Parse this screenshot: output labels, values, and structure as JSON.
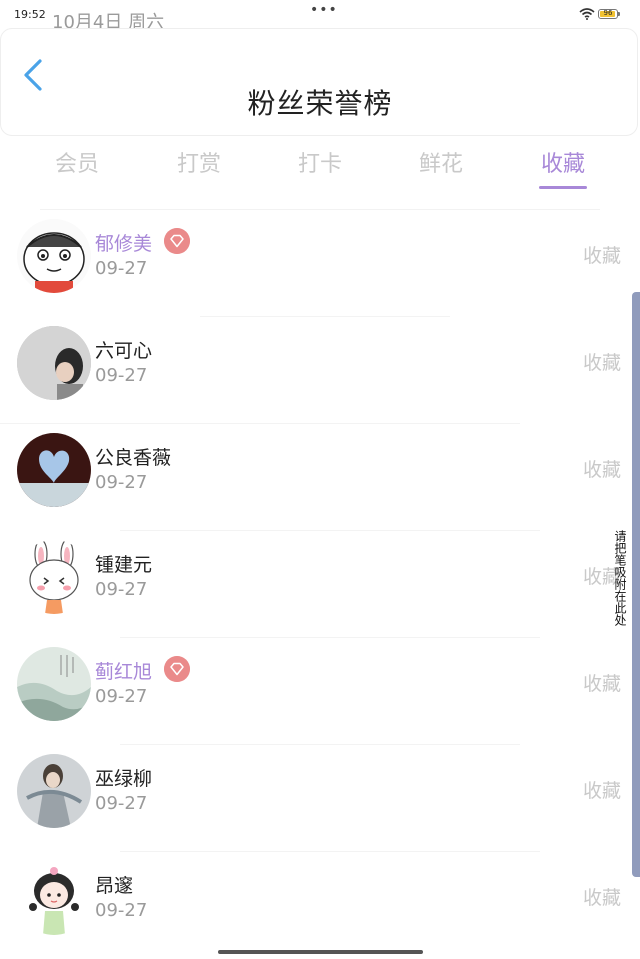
{
  "status": {
    "time": "19:52",
    "date": "10月4日 周六",
    "more": "•••",
    "battery": "96"
  },
  "header": {
    "title": "粉丝荣誉榜"
  },
  "tabs": [
    {
      "label": "会员"
    },
    {
      "label": "打赏"
    },
    {
      "label": "打卡"
    },
    {
      "label": "鲜花"
    },
    {
      "label": "收藏"
    }
  ],
  "active_tab": "收藏",
  "rows": [
    {
      "name": "郁修美",
      "date": "09-27",
      "action": "收藏",
      "vip": true
    },
    {
      "name": "六可心",
      "date": "09-27",
      "action": "收藏",
      "vip": false
    },
    {
      "name": "公良香薇",
      "date": "09-27",
      "action": "收藏",
      "vip": false
    },
    {
      "name": "锺建元",
      "date": "09-27",
      "action": "收藏",
      "vip": false
    },
    {
      "name": "蓟红旭",
      "date": "09-27",
      "action": "收藏",
      "vip": true
    },
    {
      "name": "巫绿柳",
      "date": "09-27",
      "action": "收藏",
      "vip": false
    },
    {
      "name": "昂邃",
      "date": "09-27",
      "action": "收藏",
      "vip": false
    }
  ],
  "side_panel": {
    "text": "请把笔吸附在此处"
  },
  "colors": {
    "accent": "#a888d8",
    "vip_badge": "#ea8a8a",
    "muted": "#c9c9c9"
  }
}
